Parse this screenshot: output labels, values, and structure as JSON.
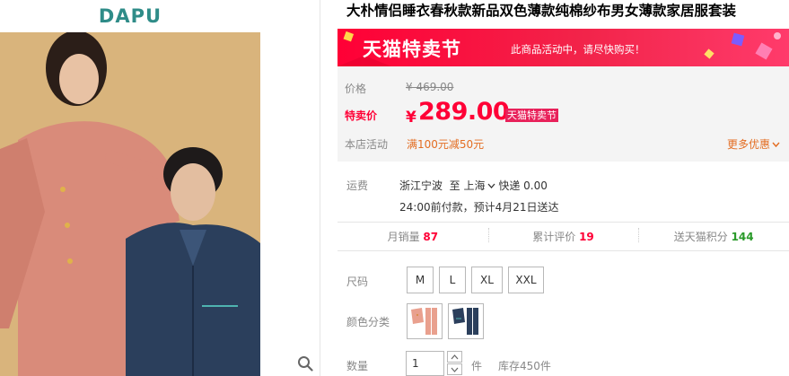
{
  "brand": {
    "logo_text": "DAPU",
    "accent": "#2f8c88"
  },
  "product": {
    "title": "大朴情侣睡衣春秋款新品双色薄款纯棉纱布男女薄款家居服套装"
  },
  "promo_banner": {
    "title": "天猫特卖节",
    "subtitle": "此商品活动中，请尽快购买！",
    "color": "#ff0036"
  },
  "pricing": {
    "price_label": "价格",
    "original_price": "¥ 469.00",
    "promo_label": "特卖价",
    "currency_symbol": "¥",
    "sale_price": "289.00",
    "sale_tag": "天猫特卖节",
    "activity_label": "本店活动",
    "activity_text": "满100元减50元",
    "more_label": "更多优惠"
  },
  "shipping": {
    "label": "运费",
    "origin": "浙江宁波",
    "to": "至",
    "destination": "上海",
    "method": "快递 0.00",
    "eta": "24:00前付款，预计4月21日送达"
  },
  "stats": [
    {
      "label": "月销量",
      "value": "87"
    },
    {
      "label": "累计评价",
      "value": "19"
    },
    {
      "label": "送天猫积分",
      "value": "144"
    }
  ],
  "options": {
    "size_label": "尺码",
    "sizes": [
      "M",
      "L",
      "XL",
      "XXL"
    ],
    "color_label": "颜色分类",
    "colors": [
      "pink-set",
      "navy-set"
    ],
    "quantity_label": "数量",
    "quantity": "1",
    "unit": "件",
    "stock": "库存450件"
  }
}
